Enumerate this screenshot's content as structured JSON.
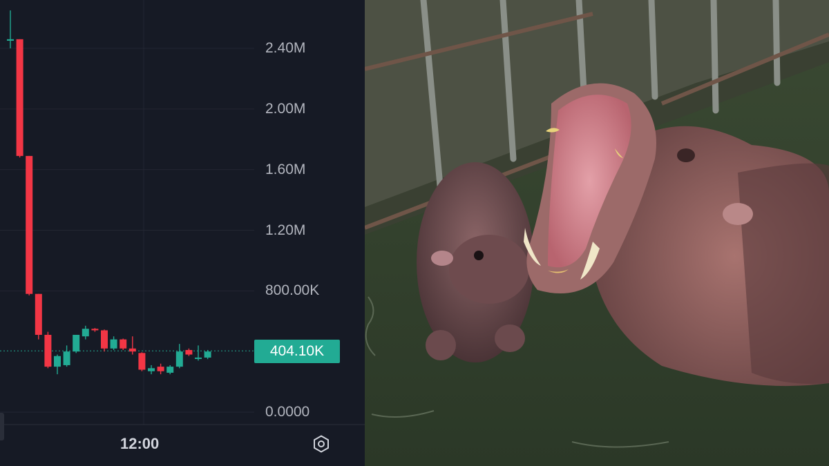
{
  "chart_data": {
    "type": "candlestick",
    "y_ticks": [
      "2.40M",
      "2.00M",
      "1.60M",
      "1.20M",
      "800.00K",
      "0.0000"
    ],
    "ylim": [
      0,
      2700000
    ],
    "x_tick": "12:00",
    "current_price": 404100,
    "current_price_label": "404.10K",
    "up_color": "#22ab94",
    "down_color": "#f23645",
    "candles": [
      {
        "open": 2450000,
        "high": 2650000,
        "low": 2400000,
        "close": 2460000
      },
      {
        "open": 2460000,
        "high": 2460000,
        "low": 1680000,
        "close": 1690000
      },
      {
        "open": 1690000,
        "high": 1690000,
        "low": 770000,
        "close": 780000
      },
      {
        "open": 780000,
        "high": 780000,
        "low": 480000,
        "close": 510000
      },
      {
        "open": 510000,
        "high": 530000,
        "low": 290000,
        "close": 300000
      },
      {
        "open": 300000,
        "high": 380000,
        "low": 250000,
        "close": 370000
      },
      {
        "open": 310000,
        "high": 440000,
        "low": 300000,
        "close": 400000
      },
      {
        "open": 400000,
        "high": 510000,
        "low": 390000,
        "close": 510000
      },
      {
        "open": 500000,
        "high": 570000,
        "low": 480000,
        "close": 550000
      },
      {
        "open": 550000,
        "high": 555000,
        "low": 530000,
        "close": 540000
      },
      {
        "open": 540000,
        "high": 545000,
        "low": 400000,
        "close": 420000
      },
      {
        "open": 420000,
        "high": 500000,
        "low": 410000,
        "close": 480000
      },
      {
        "open": 480000,
        "high": 485000,
        "low": 410000,
        "close": 420000
      },
      {
        "open": 420000,
        "high": 500000,
        "low": 380000,
        "close": 400000
      },
      {
        "open": 390000,
        "high": 395000,
        "low": 270000,
        "close": 280000
      },
      {
        "open": 270000,
        "high": 310000,
        "low": 250000,
        "close": 290000
      },
      {
        "open": 300000,
        "high": 320000,
        "low": 250000,
        "close": 270000
      },
      {
        "open": 260000,
        "high": 310000,
        "low": 250000,
        "close": 300000
      },
      {
        "open": 300000,
        "high": 450000,
        "low": 290000,
        "close": 400000
      },
      {
        "open": 410000,
        "high": 420000,
        "low": 370000,
        "close": 380000
      },
      {
        "open": 360000,
        "high": 440000,
        "low": 340000,
        "close": 360000
      },
      {
        "open": 360000,
        "high": 410000,
        "low": 350000,
        "close": 400000
      }
    ]
  },
  "icons": {
    "settings": "hexagon-gear-icon"
  },
  "photo": {
    "subject": "hippopotamus-photo"
  }
}
